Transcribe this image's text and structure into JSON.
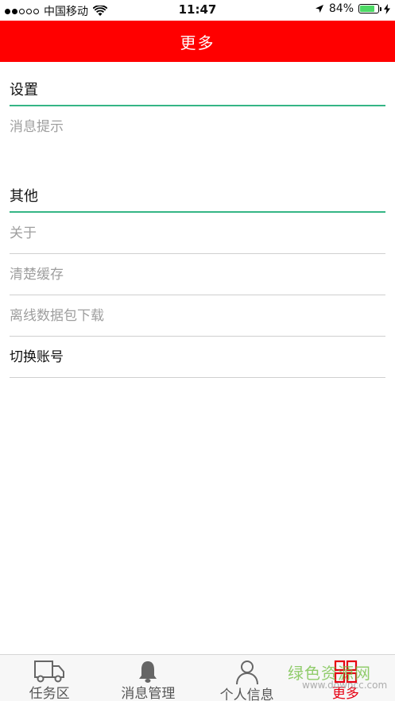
{
  "status_bar": {
    "carrier": "中国移动",
    "time": "11:47",
    "battery_percent": "84%",
    "battery_level": 0.84,
    "signal_bars_filled": 2,
    "signal_bars_total": 5
  },
  "nav": {
    "title": "更多",
    "background": "#ff0000"
  },
  "settings": {
    "header": "设置",
    "items": [
      "消息提示"
    ]
  },
  "other": {
    "header": "其他",
    "items": [
      "关于",
      "清楚缓存",
      "离线数据包下载",
      "切换账号"
    ]
  },
  "tab_bar": {
    "tabs": [
      {
        "label": "任务区",
        "icon": "truck-icon",
        "active": false
      },
      {
        "label": "消息管理",
        "icon": "bell-icon",
        "active": false
      },
      {
        "label": "个人信息",
        "icon": "person-icon",
        "active": false
      },
      {
        "label": "更多",
        "icon": "grid-icon",
        "active": true
      }
    ]
  },
  "watermark": {
    "main": "绿色资源网",
    "sub": "www.downcc.com"
  },
  "colors": {
    "accent_red": "#ff0000",
    "divider_green": "#35b585",
    "active_tab": "#e60012",
    "battery_green": "#4cd964"
  }
}
